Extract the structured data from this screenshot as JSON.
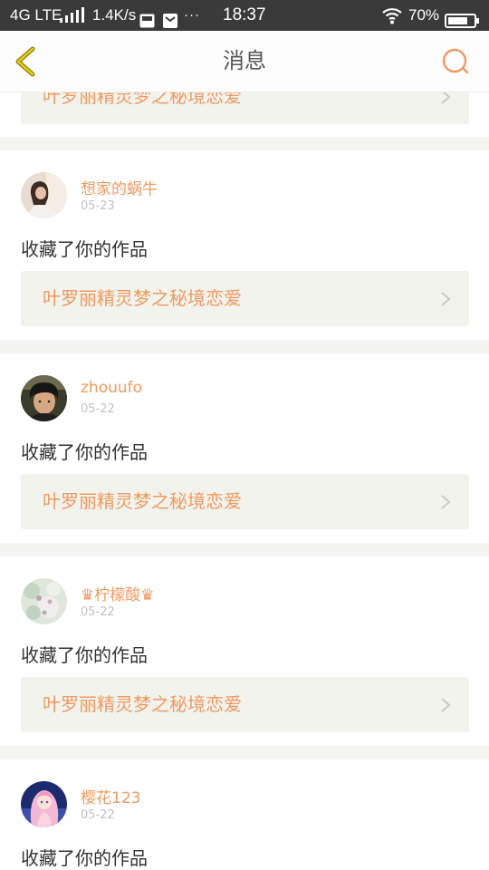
{
  "status_bar": {
    "network": "4G LTE",
    "speed": "1.4K/s",
    "more": "···",
    "time": "18:37",
    "battery": "70%"
  },
  "header": {
    "title": "消息",
    "back_icon": "chevron-left-icon",
    "search_icon": "search-icon"
  },
  "colors": {
    "accent": "#ef9a62",
    "back_arrow": "#c9ac0a",
    "card_link_bg": "#f3f3ed",
    "page_bg": "#f4f4f2"
  },
  "top_partial": {
    "work_title": "叶罗丽精灵梦之秘境恋爱"
  },
  "messages": [
    {
      "username": "想家的蜗牛",
      "date": "05-23",
      "action": "收藏了你的作品",
      "work_title": "叶罗丽精灵梦之秘境恋爱"
    },
    {
      "username": "zhouufo",
      "date": "05-22",
      "action": "收藏了你的作品",
      "work_title": "叶罗丽精灵梦之秘境恋爱"
    },
    {
      "username": "♛柠檬酸♛",
      "date": "05-22",
      "action": "收藏了你的作品",
      "work_title": "叶罗丽精灵梦之秘境恋爱"
    },
    {
      "username": "樱花123",
      "date": "05-22",
      "action": "收藏了你的作品"
    }
  ]
}
